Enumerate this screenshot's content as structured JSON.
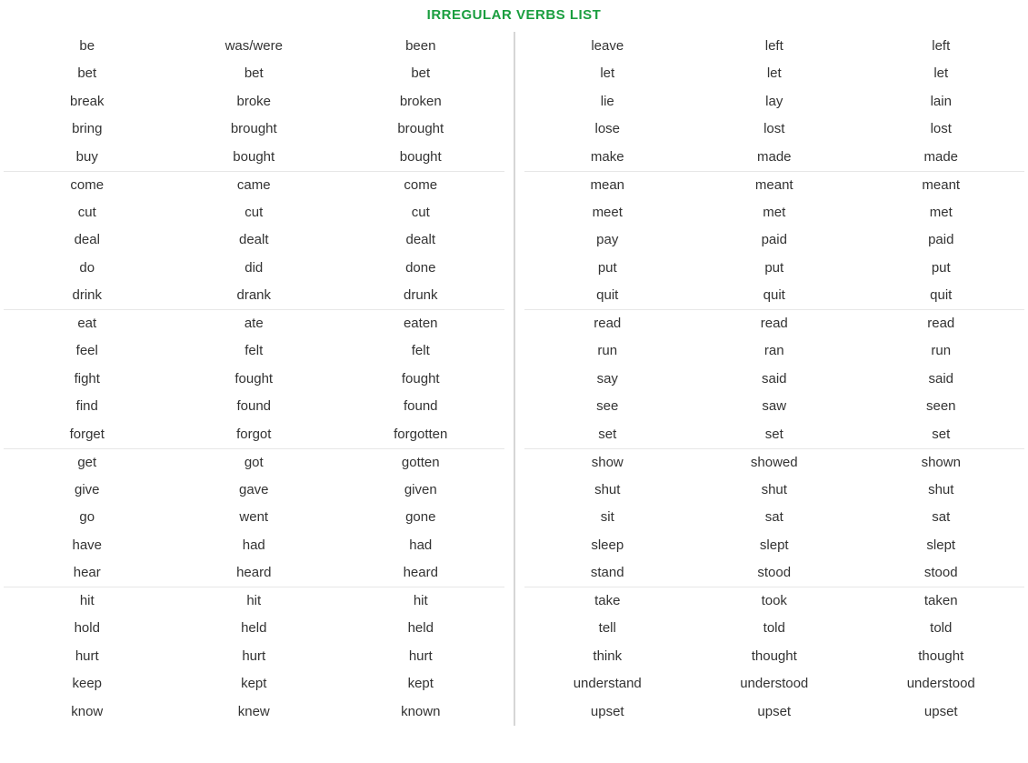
{
  "title": "IRREGULAR VERBS LIST",
  "left": [
    {
      "base": "be",
      "past": "was/were",
      "pp": "been",
      "sep": false
    },
    {
      "base": "bet",
      "past": "bet",
      "pp": "bet",
      "sep": false
    },
    {
      "base": "break",
      "past": "broke",
      "pp": "broken",
      "sep": false
    },
    {
      "base": "bring",
      "past": "brought",
      "pp": "brought",
      "sep": false
    },
    {
      "base": "buy",
      "past": "bought",
      "pp": "bought",
      "sep": false
    },
    {
      "base": "come",
      "past": "came",
      "pp": "come",
      "sep": true
    },
    {
      "base": "cut",
      "past": "cut",
      "pp": "cut",
      "sep": false
    },
    {
      "base": "deal",
      "past": "dealt",
      "pp": "dealt",
      "sep": false
    },
    {
      "base": "do",
      "past": "did",
      "pp": "done",
      "sep": false
    },
    {
      "base": "drink",
      "past": "drank",
      "pp": "drunk",
      "sep": false
    },
    {
      "base": "eat",
      "past": "ate",
      "pp": "eaten",
      "sep": true
    },
    {
      "base": "feel",
      "past": "felt",
      "pp": "felt",
      "sep": false
    },
    {
      "base": "fight",
      "past": "fought",
      "pp": "fought",
      "sep": false
    },
    {
      "base": "find",
      "past": "found",
      "pp": "found",
      "sep": false
    },
    {
      "base": "forget",
      "past": "forgot",
      "pp": "forgotten",
      "sep": false
    },
    {
      "base": "get",
      "past": "got",
      "pp": "gotten",
      "sep": true
    },
    {
      "base": "give",
      "past": "gave",
      "pp": "given",
      "sep": false
    },
    {
      "base": "go",
      "past": "went",
      "pp": "gone",
      "sep": false
    },
    {
      "base": "have",
      "past": "had",
      "pp": "had",
      "sep": false
    },
    {
      "base": "hear",
      "past": "heard",
      "pp": "heard",
      "sep": false
    },
    {
      "base": "hit",
      "past": "hit",
      "pp": "hit",
      "sep": true
    },
    {
      "base": "hold",
      "past": "held",
      "pp": "held",
      "sep": false
    },
    {
      "base": "hurt",
      "past": "hurt",
      "pp": "hurt",
      "sep": false
    },
    {
      "base": "keep",
      "past": "kept",
      "pp": "kept",
      "sep": false
    },
    {
      "base": "know",
      "past": "knew",
      "pp": "known",
      "sep": false
    }
  ],
  "right": [
    {
      "base": "leave",
      "past": "left",
      "pp": "left",
      "sep": false
    },
    {
      "base": "let",
      "past": "let",
      "pp": "let",
      "sep": false
    },
    {
      "base": "lie",
      "past": "lay",
      "pp": "lain",
      "sep": false
    },
    {
      "base": "lose",
      "past": "lost",
      "pp": "lost",
      "sep": false
    },
    {
      "base": "make",
      "past": "made",
      "pp": "made",
      "sep": false
    },
    {
      "base": "mean",
      "past": "meant",
      "pp": "meant",
      "sep": true
    },
    {
      "base": "meet",
      "past": "met",
      "pp": "met",
      "sep": false
    },
    {
      "base": "pay",
      "past": "paid",
      "pp": "paid",
      "sep": false
    },
    {
      "base": "put",
      "past": "put",
      "pp": "put",
      "sep": false
    },
    {
      "base": "quit",
      "past": "quit",
      "pp": "quit",
      "sep": false
    },
    {
      "base": "read",
      "past": "read",
      "pp": "read",
      "sep": true
    },
    {
      "base": "run",
      "past": "ran",
      "pp": "run",
      "sep": false
    },
    {
      "base": "say",
      "past": "said",
      "pp": "said",
      "sep": false
    },
    {
      "base": "see",
      "past": "saw",
      "pp": "seen",
      "sep": false
    },
    {
      "base": "set",
      "past": "set",
      "pp": "set",
      "sep": false
    },
    {
      "base": "show",
      "past": "showed",
      "pp": "shown",
      "sep": true
    },
    {
      "base": "shut",
      "past": "shut",
      "pp": "shut",
      "sep": false
    },
    {
      "base": "sit",
      "past": "sat",
      "pp": "sat",
      "sep": false
    },
    {
      "base": "sleep",
      "past": "slept",
      "pp": "slept",
      "sep": false
    },
    {
      "base": "stand",
      "past": "stood",
      "pp": "stood",
      "sep": false
    },
    {
      "base": "take",
      "past": "took",
      "pp": "taken",
      "sep": true
    },
    {
      "base": "tell",
      "past": "told",
      "pp": "told",
      "sep": false
    },
    {
      "base": "think",
      "past": "thought",
      "pp": "thought",
      "sep": false
    },
    {
      "base": "understand",
      "past": "understood",
      "pp": "understood",
      "sep": false
    },
    {
      "base": "upset",
      "past": "upset",
      "pp": "upset",
      "sep": false
    }
  ]
}
